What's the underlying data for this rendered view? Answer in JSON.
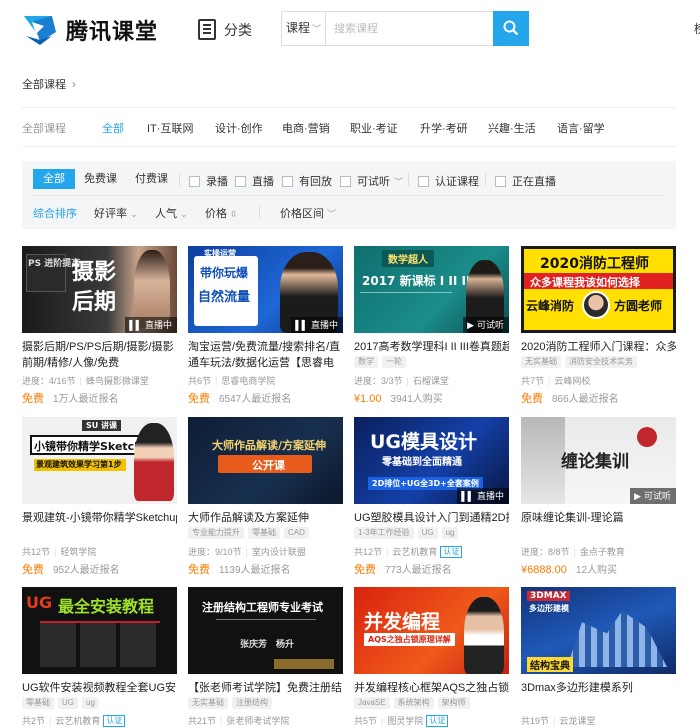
{
  "header": {
    "brand": "腾讯课堂",
    "category_label": "分类",
    "search_scope": "课程",
    "search_placeholder": "搜索课程",
    "edge_text": "榜"
  },
  "breadcrumb": {
    "label": "全部课程"
  },
  "categories": {
    "all": "全部课程",
    "items": [
      "全部",
      "IT·互联网",
      "设计·创作",
      "电商·营销",
      "职业·考证",
      "升学·考研",
      "兴趣·生活",
      "语言·留学"
    ]
  },
  "filters": {
    "pills": [
      "全部",
      "免费课",
      "付费课"
    ],
    "checks": [
      "录播",
      "直播",
      "有回放",
      "可试听",
      "认证课程",
      "正在直播"
    ],
    "sorts": [
      "综合排序",
      "好评率",
      "人气",
      "价格",
      "价格区间"
    ]
  },
  "courses": [
    {
      "title": "摄影后期/PS/PS后期/摄影/摄影前期/精修/人像/免费",
      "thumb_text": [
        "摄影",
        "后期"
      ],
      "thumb_sub": "PS 进阶提高",
      "badge": "直播中",
      "meta": [
        "进度：4/16节",
        "蜂鸟摄影微课堂"
      ],
      "price": "免费",
      "enrolled": "1万人最近报名",
      "tags": []
    },
    {
      "title": "淘宝运营/免费流量/搜索排名/直通车玩法/数据化运营【思睿电商】",
      "thumb_text": [
        "带你玩爆",
        "自然流量"
      ],
      "thumb_sub": "实操运营",
      "badge": "直播中",
      "meta": [
        "共6节",
        "思睿电商学院"
      ],
      "price": "免费",
      "enrolled": "6547人最近报名",
      "tags": []
    },
    {
      "title": "2017高考数学理科I II III卷真题超...",
      "thumb_text": [
        "2017 新课标 I II III"
      ],
      "thumb_sub": "数学超人",
      "badge": "可试听",
      "meta": [
        "进度：3/3节",
        "石榴课堂"
      ],
      "price": "¥1.00",
      "enrolled": "3941人购买",
      "tags": [
        "数学",
        "一轮"
      ]
    },
    {
      "title": "2020消防工程师入门课程：众多...",
      "thumb_text": [
        "2020消防工程师",
        "众多课程我该如何选择",
        "云峰消防",
        "方圆老师"
      ],
      "thumb_sub": "",
      "badge": "",
      "meta": [
        "共7节",
        "云峰网校"
      ],
      "price": "免费",
      "enrolled": "866人最近报名",
      "tags": [
        "无实基础",
        "消防安全技术实务"
      ]
    },
    {
      "title": "景观建筑-小镜带你精学Sketchup",
      "thumb_text": [
        "小镜带你精学Sketchup",
        "景观建筑效果学习第1步"
      ],
      "thumb_sub": "SU 讲课",
      "badge": "",
      "meta": [
        "共12节",
        "轻筑学院"
      ],
      "price": "免费",
      "enrolled": "952人最近报名",
      "tags": []
    },
    {
      "title": "大师作品解读及方案延伸",
      "thumb_text": [
        "大师作品解读/方案延伸",
        "公开课"
      ],
      "thumb_sub": "",
      "badge": "",
      "meta": [
        "进度：9/10节",
        "室内设计联盟"
      ],
      "price": "免费",
      "enrolled": "1139人最近报名",
      "tags": [
        "专业能力提升",
        "零基础",
        "CAD"
      ]
    },
    {
      "title": "UG塑胶模具设计入门到通精2D排...",
      "thumb_text": [
        "UG模具设计",
        "零基础到全面精通",
        "2D排位+UG全3D+全套案例"
      ],
      "thumb_sub": "",
      "badge": "直播中",
      "meta": [
        "共12节",
        "云艺机教育"
      ],
      "price": "免费",
      "enrolled": "773人最近报名",
      "tags": [
        "1-3年工作经验",
        "UG",
        "ug"
      ],
      "verified": "认证"
    },
    {
      "title": "原味缠论集训-理论篇",
      "thumb_text": [
        "缠论集训"
      ],
      "thumb_sub": "",
      "badge": "可试听",
      "meta": [
        "进度：8/8节",
        "金点子教育"
      ],
      "price": "¥6888.00",
      "enrolled": "12人购买",
      "tags": []
    },
    {
      "title": "UG软件安装视频教程全套UG安...",
      "thumb_text": [
        "UG",
        "最全安装教程"
      ],
      "thumb_sub": "",
      "badge": "",
      "meta": [
        "共2节",
        "云艺机教育"
      ],
      "price": "",
      "enrolled": "",
      "tags": [
        "零基础",
        "UG",
        "ug"
      ],
      "verified": "认证"
    },
    {
      "title": "【张老师考试学院】免费注册结...",
      "thumb_text": [
        "注册结构工程师专业考试",
        "张庆芳　杨升"
      ],
      "thumb_sub": "",
      "badge": "",
      "meta": [
        "共21节",
        "张老师考试学院"
      ],
      "price": "",
      "enrolled": "",
      "tags": [
        "无实基础",
        "注册结构"
      ]
    },
    {
      "title": "并发编程核心框架AQS之独占锁...",
      "thumb_text": [
        "并发编程",
        "AQS之独占锁原理详解"
      ],
      "thumb_sub": "",
      "badge": "",
      "meta": [
        "共5节",
        "图灵学院"
      ],
      "price": "",
      "enrolled": "",
      "tags": [
        "JavaSE",
        "系统架构",
        "架构师"
      ],
      "verified": "认证"
    },
    {
      "title": "3Dmax多边形建模系列",
      "thumb_text": [
        "3DMAX",
        "多边形建模",
        "结构宝典"
      ],
      "thumb_sub": "",
      "badge": "",
      "meta": [
        "共19节",
        "云龙课堂"
      ],
      "price": "",
      "enrolled": "",
      "tags": []
    }
  ],
  "colors": {
    "accent": "#23a6ea",
    "free": "#ff7a00"
  }
}
